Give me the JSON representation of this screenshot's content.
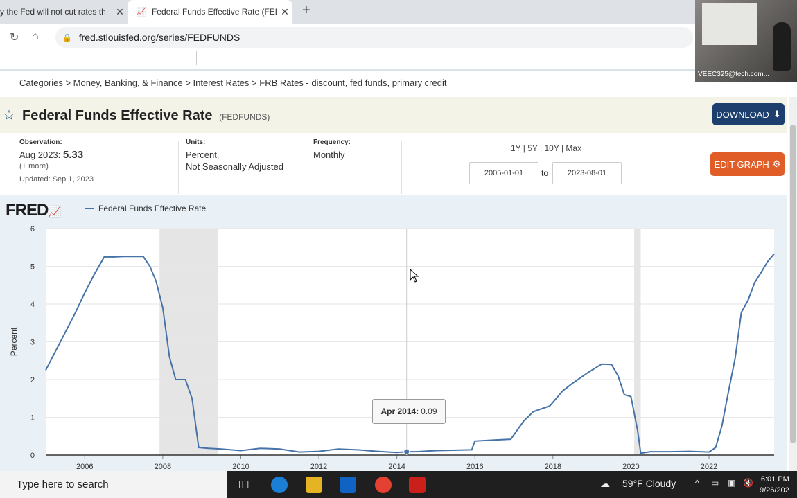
{
  "browser": {
    "tabs": [
      {
        "title": "y the Fed will not cut rates th"
      },
      {
        "title": "Federal Funds Effective Rate (FEDFUNDS)"
      }
    ],
    "url": "fred.stlouisfed.org/series/FEDFUNDS"
  },
  "webcam": {
    "label": "VEEC325@tech.com..."
  },
  "breadcrumb": "Categories > Money, Banking, & Finance > Interest Rates > FRB Rates - discount, fed funds, primary credit",
  "series": {
    "title": "Federal Funds Effective Rate",
    "id": "(FEDFUNDS)",
    "download_label": "DOWNLOAD",
    "edit_graph_label": "EDIT GRAPH"
  },
  "meta": {
    "observation_label": "Observation:",
    "observation_date": "Aug 2023:",
    "observation_value": "5.33",
    "more": "(+ more)",
    "updated": "Updated: Sep 1, 2023",
    "units_label": "Units:",
    "units_line1": "Percent,",
    "units_line2": "Not Seasonally Adjusted",
    "frequency_label": "Frequency:",
    "frequency_value": "Monthly"
  },
  "range": {
    "links": "1Y | 5Y | 10Y | Max",
    "start": "2005-01-01",
    "to": "to",
    "end": "2023-08-01"
  },
  "fred_logo": "FRED",
  "tooltip": {
    "date": "Apr 2014:",
    "value": "0.09"
  },
  "chart_data": {
    "type": "line",
    "title": "",
    "ylabel": "Percent",
    "xlabel": "",
    "ylim": [
      0,
      6
    ],
    "xlim": [
      2005.0,
      2023.67
    ],
    "yticks": [
      0,
      1,
      2,
      3,
      4,
      5,
      6
    ],
    "xticks": [
      2006,
      2008,
      2010,
      2012,
      2014,
      2016,
      2018,
      2020,
      2022
    ],
    "grid": true,
    "legend": "top-left",
    "recessions": [
      [
        2007.917,
        2009.417
      ],
      [
        2020.083,
        2020.25
      ]
    ],
    "series": [
      {
        "name": "Federal Funds Effective Rate",
        "color": "#4572a7",
        "points": [
          [
            2005.0,
            2.25
          ],
          [
            2005.25,
            2.75
          ],
          [
            2005.5,
            3.25
          ],
          [
            2005.75,
            3.75
          ],
          [
            2006.0,
            4.3
          ],
          [
            2006.25,
            4.8
          ],
          [
            2006.5,
            5.25
          ],
          [
            2006.75,
            5.25
          ],
          [
            2007.0,
            5.26
          ],
          [
            2007.5,
            5.26
          ],
          [
            2007.67,
            5.0
          ],
          [
            2007.83,
            4.6
          ],
          [
            2008.0,
            3.9
          ],
          [
            2008.17,
            2.6
          ],
          [
            2008.33,
            2.0
          ],
          [
            2008.58,
            2.0
          ],
          [
            2008.75,
            1.5
          ],
          [
            2008.92,
            0.2
          ],
          [
            2009.17,
            0.18
          ],
          [
            2009.5,
            0.16
          ],
          [
            2010.0,
            0.12
          ],
          [
            2010.5,
            0.18
          ],
          [
            2011.0,
            0.16
          ],
          [
            2011.5,
            0.08
          ],
          [
            2012.0,
            0.1
          ],
          [
            2012.5,
            0.16
          ],
          [
            2013.0,
            0.14
          ],
          [
            2013.5,
            0.1
          ],
          [
            2014.0,
            0.07
          ],
          [
            2014.25,
            0.09
          ],
          [
            2014.5,
            0.09
          ],
          [
            2015.0,
            0.12
          ],
          [
            2015.92,
            0.14
          ],
          [
            2016.0,
            0.37
          ],
          [
            2016.5,
            0.4
          ],
          [
            2016.92,
            0.42
          ],
          [
            2017.25,
            0.9
          ],
          [
            2017.5,
            1.15
          ],
          [
            2017.92,
            1.3
          ],
          [
            2018.25,
            1.7
          ],
          [
            2018.5,
            1.9
          ],
          [
            2018.92,
            2.2
          ],
          [
            2019.25,
            2.41
          ],
          [
            2019.5,
            2.4
          ],
          [
            2019.67,
            2.1
          ],
          [
            2019.83,
            1.6
          ],
          [
            2020.0,
            1.55
          ],
          [
            2020.17,
            0.65
          ],
          [
            2020.25,
            0.05
          ],
          [
            2020.5,
            0.09
          ],
          [
            2021.0,
            0.09
          ],
          [
            2021.5,
            0.1
          ],
          [
            2022.0,
            0.08
          ],
          [
            2022.17,
            0.2
          ],
          [
            2022.33,
            0.77
          ],
          [
            2022.5,
            1.68
          ],
          [
            2022.67,
            2.56
          ],
          [
            2022.83,
            3.78
          ],
          [
            2023.0,
            4.1
          ],
          [
            2023.17,
            4.57
          ],
          [
            2023.33,
            4.83
          ],
          [
            2023.5,
            5.12
          ],
          [
            2023.67,
            5.33
          ]
        ]
      }
    ]
  },
  "taskbar": {
    "search_placeholder": "Type here to search",
    "weather": "59°F  Cloudy",
    "time": "6:01 PM",
    "date": "9/26/202"
  }
}
